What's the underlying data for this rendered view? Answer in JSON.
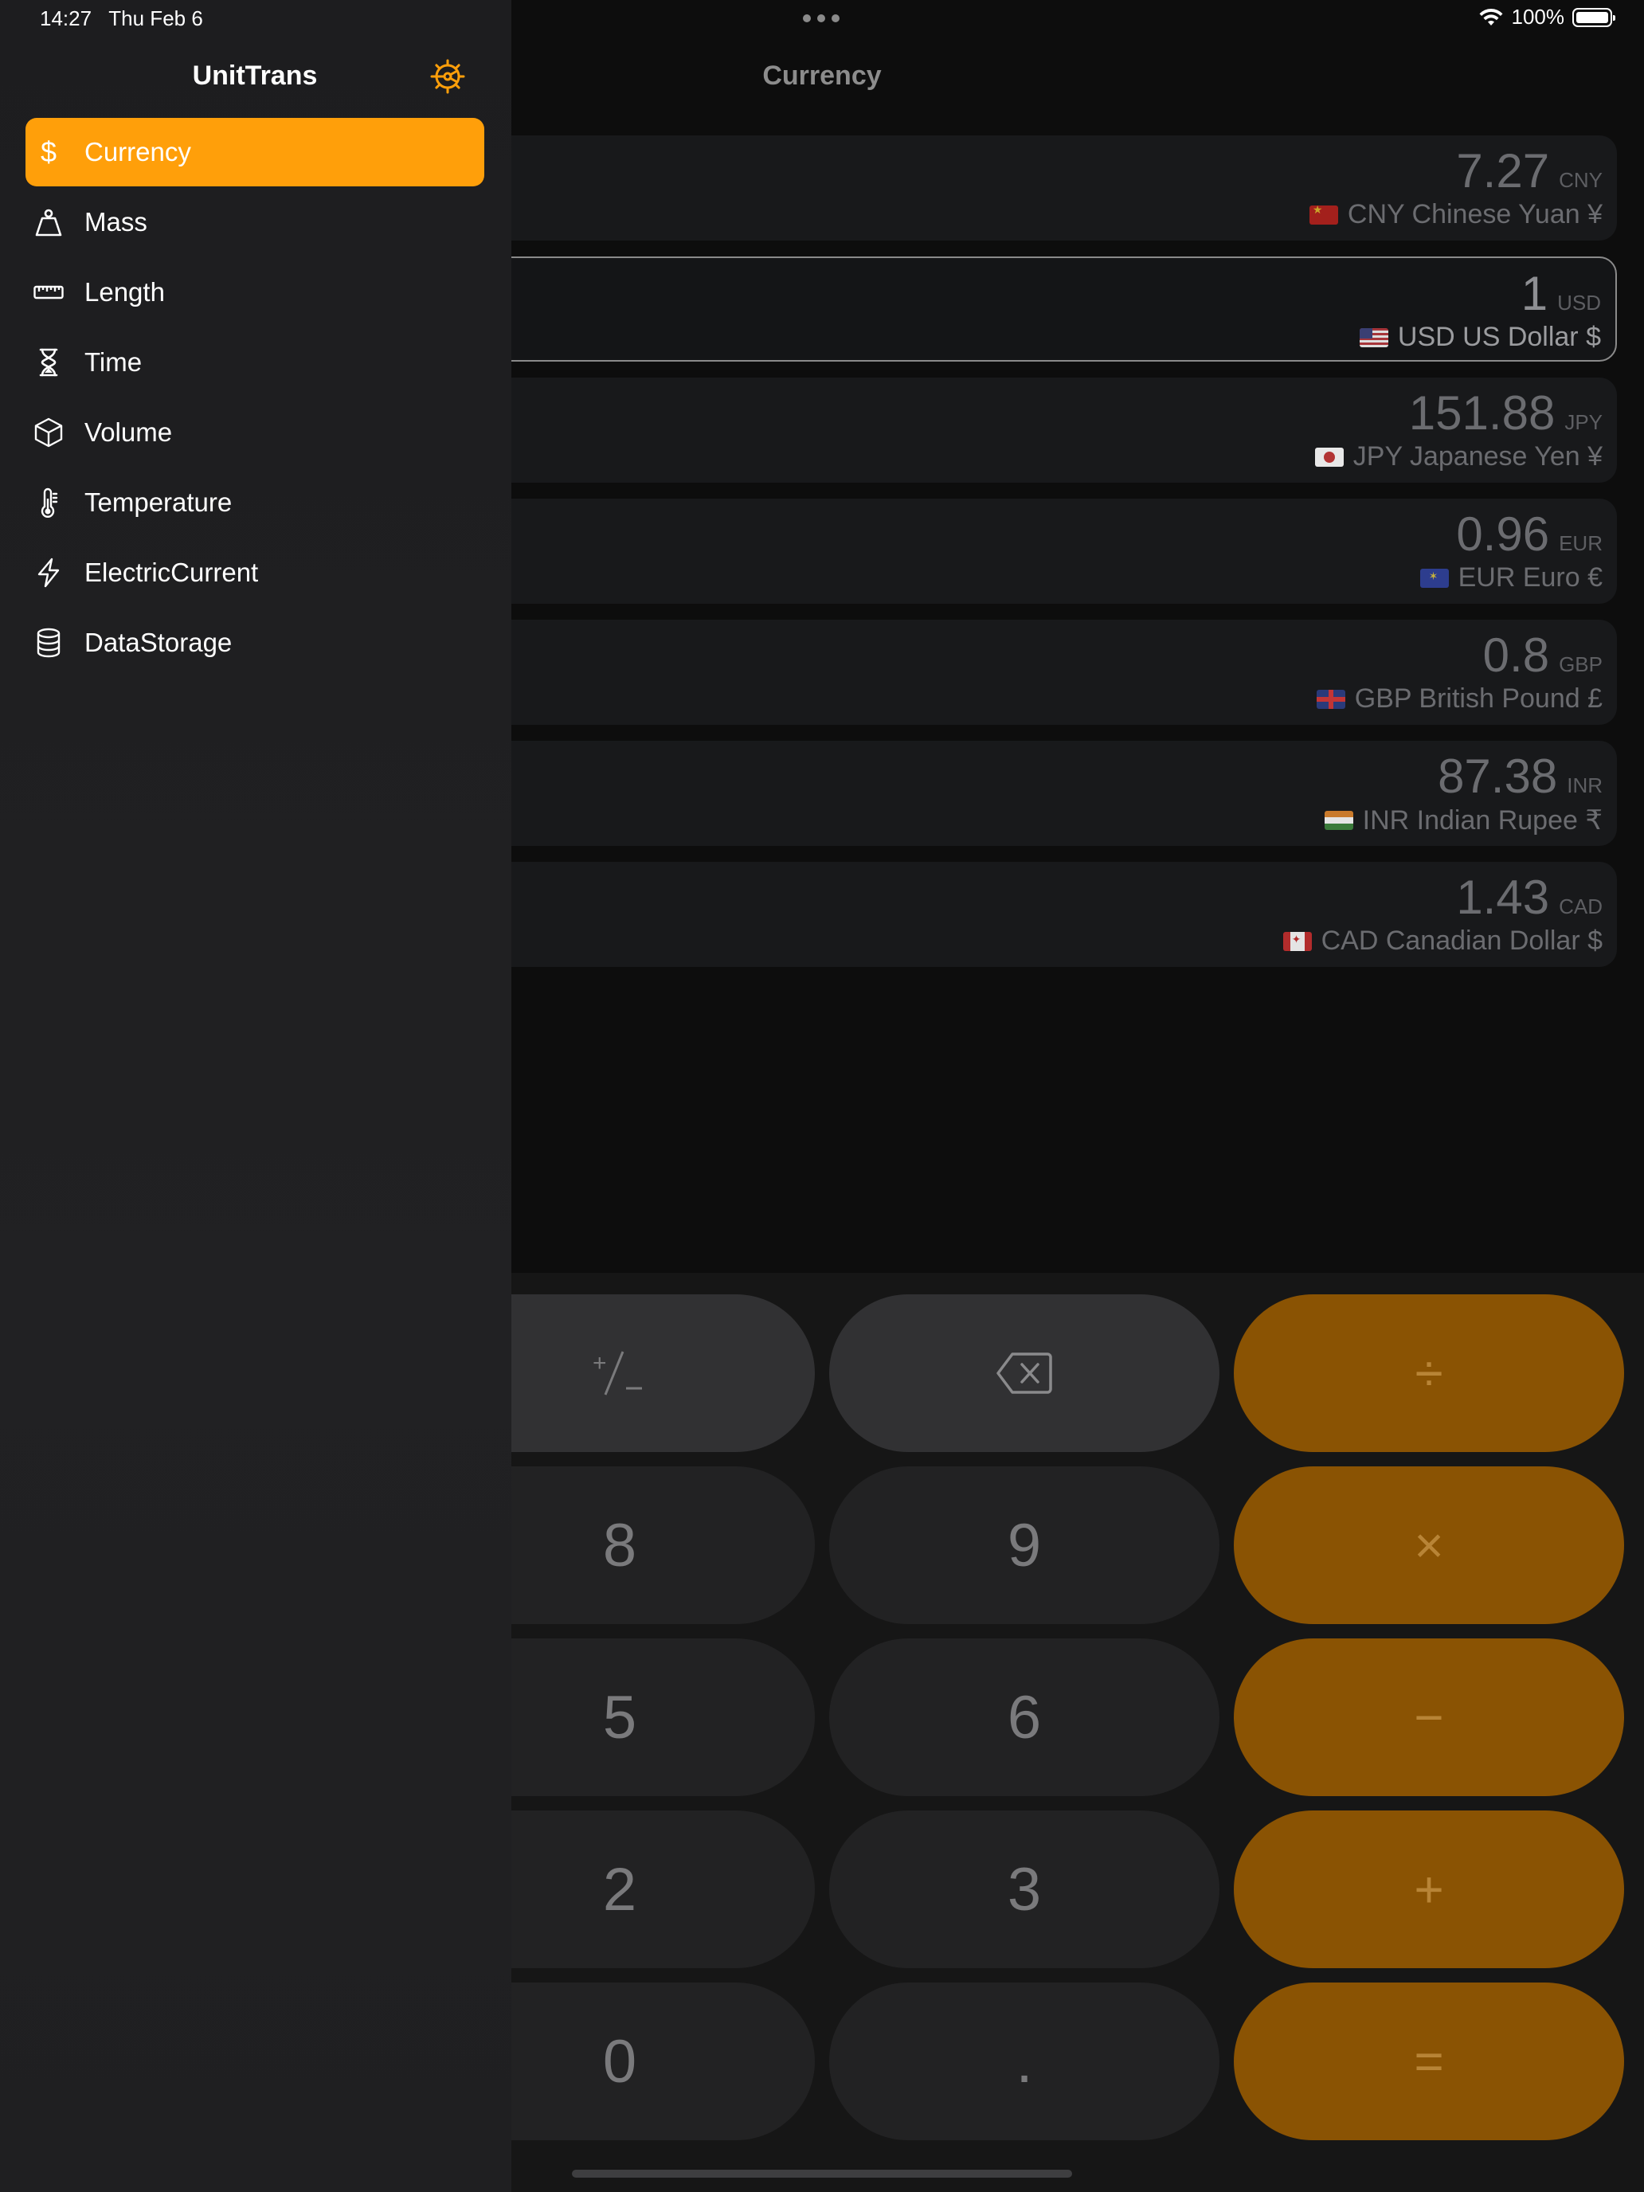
{
  "status_bar": {
    "time": "14:27",
    "date": "Thu Feb 6",
    "battery": "100%"
  },
  "main": {
    "title": "Currency",
    "rows": [
      {
        "value": "7.27",
        "code": "CNY",
        "name": "CNY Chinese Yuan ¥",
        "flag": "cny",
        "active": false
      },
      {
        "value": "1",
        "code": "USD",
        "name": "USD US Dollar $",
        "flag": "usd",
        "active": true
      },
      {
        "value": "151.88",
        "code": "JPY",
        "name": "JPY Japanese Yen ¥",
        "flag": "jpy",
        "active": false
      },
      {
        "value": "0.96",
        "code": "EUR",
        "name": "EUR Euro €",
        "flag": "eur",
        "active": false
      },
      {
        "value": "0.8",
        "code": "GBP",
        "name": "GBP British Pound £",
        "flag": "gbp",
        "active": false
      },
      {
        "value": "87.38",
        "code": "INR",
        "name": "INR Indian Rupee ₹",
        "flag": "inr",
        "active": false
      },
      {
        "value": "1.43",
        "code": "CAD",
        "name": "CAD Canadian Dollar $",
        "flag": "cad",
        "active": false
      }
    ]
  },
  "keypad": {
    "plus_minus": "+/−",
    "backspace_icon": "delete-left-icon",
    "divide": "÷",
    "multiply": "×",
    "minus": "−",
    "plus": "+",
    "equals": "=",
    "k8": "8",
    "k9": "9",
    "k5": "5",
    "k6": "6",
    "k2": "2",
    "k3": "3",
    "k0": "0",
    "dot": "."
  },
  "sidebar": {
    "app_title": "UnitTrans",
    "settings_icon": "gear-icon",
    "accent": "#ff9f0a",
    "items": [
      {
        "label": "Currency",
        "icon": "dollar-icon",
        "selected": true
      },
      {
        "label": "Mass",
        "icon": "weight-icon",
        "selected": false
      },
      {
        "label": "Length",
        "icon": "ruler-icon",
        "selected": false
      },
      {
        "label": "Time",
        "icon": "hourglass-icon",
        "selected": false
      },
      {
        "label": "Volume",
        "icon": "cube-icon",
        "selected": false
      },
      {
        "label": "Temperature",
        "icon": "thermometer-icon",
        "selected": false
      },
      {
        "label": "ElectricCurrent",
        "icon": "bolt-icon",
        "selected": false
      },
      {
        "label": "DataStorage",
        "icon": "database-icon",
        "selected": false
      }
    ]
  }
}
